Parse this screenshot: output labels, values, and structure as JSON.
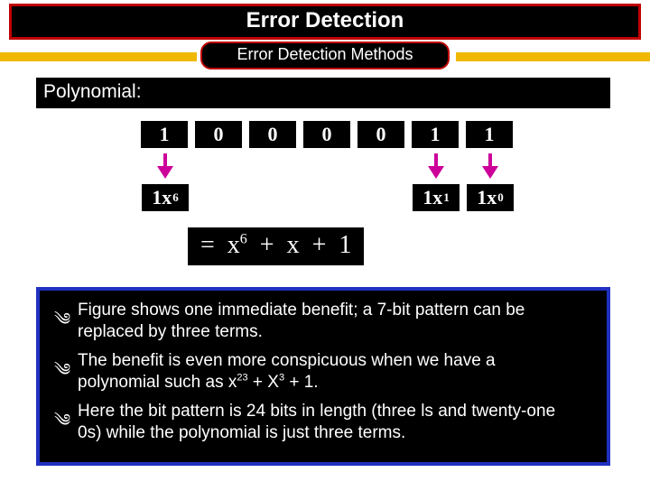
{
  "title": "Error Detection",
  "subtitle": "Error Detection Methods",
  "section_label": "Polynomial:",
  "bits": [
    "1",
    "0",
    "0",
    "0",
    "0",
    "1",
    "1"
  ],
  "terms": {
    "t0": {
      "coef": "1",
      "var": "x",
      "exp": "6"
    },
    "t1": {
      "coef": "1",
      "var": "x",
      "exp": "1"
    },
    "t2": {
      "coef": "1",
      "var": "x",
      "exp": "0"
    }
  },
  "equation": {
    "eq": "=",
    "var": "x",
    "exp": "6",
    "plus1": "+",
    "mid": "x",
    "plus2": "+",
    "one": "1"
  },
  "bullets": {
    "b1a": "Figure shows one immediate benefit; a 7-bit pattern can be",
    "b1b": "replaced by three terms.",
    "b2a": "The benefit is even more conspicuous when we have a",
    "b2b_pre": "polynomial such as x",
    "b2b_e1": "23",
    "b2b_mid": " + X",
    "b2b_e2": "3",
    "b2b_post": " + 1.",
    "b3a": "Here the bit pattern is 24 bits in length (three ls and twenty-one",
    "b3b": "0s) while the polynomial is just three terms.",
    "glyph": "༄"
  }
}
